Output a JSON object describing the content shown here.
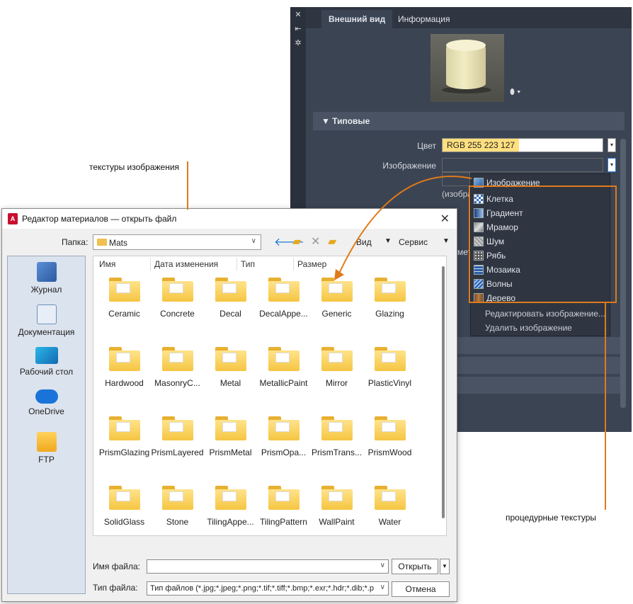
{
  "palette": {
    "tabs": [
      "Внешний вид",
      "Информация"
    ],
    "strip_icons": [
      "close-icon",
      "pin-icon",
      "settings-icon"
    ],
    "section": "Типовые",
    "color_label": "Цвет",
    "color_value": "RGB 255 223 127",
    "image_label": "Изображение",
    "partial_text": "(изобра",
    "partial_text2": "мет"
  },
  "menu": {
    "top_item": "Изображение",
    "procedural": [
      "Клетка",
      "Градиент",
      "Мрамор",
      "Шум",
      "Рябь",
      "Мозаика",
      "Волны",
      "Дерево"
    ],
    "actions": [
      "Редактировать изображение...",
      "Удалить изображение"
    ]
  },
  "dialog": {
    "title": "Редактор материалов — открыть файл",
    "app_badge": "A",
    "folder_label": "Папка:",
    "folder_value": "Mats",
    "view_label": "Вид",
    "service_label": "Сервис",
    "places": [
      "Журнал",
      "Документация",
      "Рабочий стол",
      "OneDrive",
      "FTP"
    ],
    "columns": [
      "Имя",
      "Дата изменения",
      "Тип",
      "Размер"
    ],
    "items": [
      "Ceramic",
      "Concrete",
      "Decal",
      "DecalAppe...",
      "Generic",
      "Glazing",
      "Hardwood",
      "MasonryC...",
      "Metal",
      "MetallicPaint",
      "Mirror",
      "PlasticVinyl",
      "PrismGlazing",
      "PrismLayered",
      "PrismMetal",
      "PrismOpa...",
      "PrismTrans...",
      "PrismWood",
      "SolidGlass",
      "Stone",
      "TilingAppe...",
      "TilingPattern",
      "WallPaint",
      "Water"
    ],
    "filename_label": "Имя файла:",
    "filename_value": "",
    "open_button": "Открыть",
    "filetype_label": "Тип файла:",
    "filetype_value": "Тип файлов  (*.jpg;*.jpeg;*.png;*.tif;*.tiff;*.bmp;*.exr;*.hdr;*.dib;*.pcx",
    "cancel_button": "Отмена"
  },
  "callouts": {
    "image_textures": "текстуры изображения",
    "procedural_textures": "процедурные текстуры"
  },
  "colors": {
    "accent_orange": "#e07a1a",
    "highlight_yellow": "#ffdf7f",
    "palette_bg": "#3b4453"
  }
}
